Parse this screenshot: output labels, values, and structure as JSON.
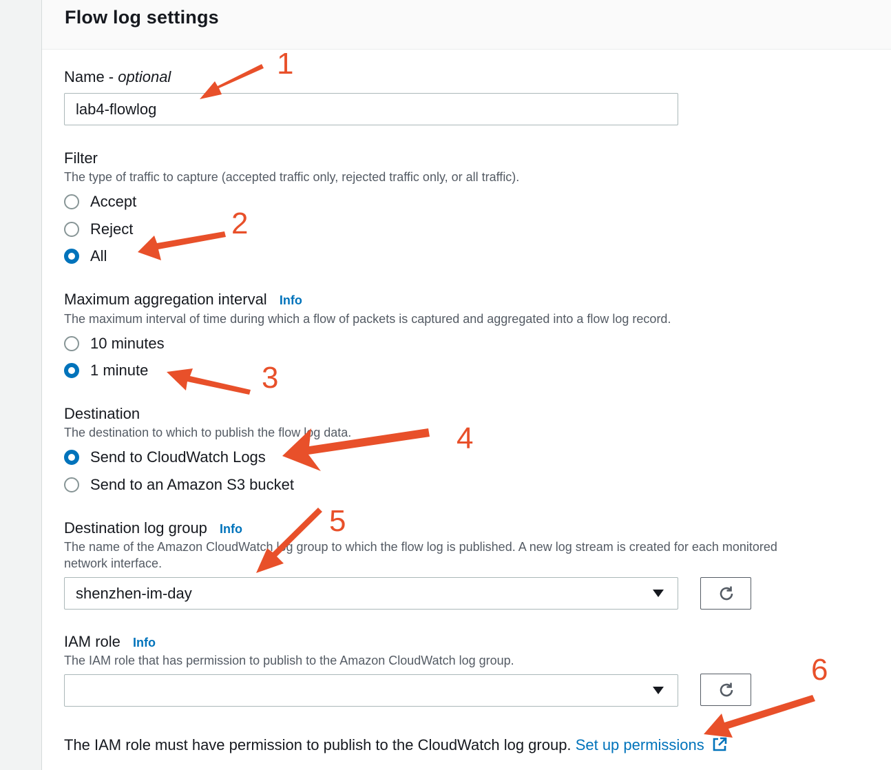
{
  "panel": {
    "title": "Flow log settings"
  },
  "name_field": {
    "label": "Name - ",
    "optional": "optional",
    "value": "lab4-flowlog"
  },
  "filter": {
    "label": "Filter",
    "description": "The type of traffic to capture (accepted traffic only, rejected traffic only, or all traffic).",
    "options": [
      {
        "label": "Accept",
        "checked": false
      },
      {
        "label": "Reject",
        "checked": false
      },
      {
        "label": "All",
        "checked": true
      }
    ]
  },
  "aggregation": {
    "label": "Maximum aggregation interval",
    "info": "Info",
    "description": "The maximum interval of time during which a flow of packets is captured and aggregated into a flow log record.",
    "options": [
      {
        "label": "10 minutes",
        "checked": false
      },
      {
        "label": "1 minute",
        "checked": true
      }
    ]
  },
  "destination": {
    "label": "Destination",
    "description": "The destination to which to publish the flow log data.",
    "options": [
      {
        "label": "Send to CloudWatch Logs",
        "checked": true
      },
      {
        "label": "Send to an Amazon S3 bucket",
        "checked": false
      }
    ]
  },
  "log_group": {
    "label": "Destination log group",
    "info": "Info",
    "description_line1": "The name of the Amazon CloudWatch log group to which the flow log is published. A new log stream is created for each monitored",
    "description_line2": "network interface.",
    "value": "shenzhen-im-day"
  },
  "iam_role": {
    "label": "IAM role",
    "info": "Info",
    "description": "The IAM role that has permission to publish to the Amazon CloudWatch log group.",
    "value": ""
  },
  "footer": {
    "note": "The IAM role must have permission to publish to the CloudWatch log group.",
    "link": "Set up permissions"
  },
  "annotations": [
    "1",
    "2",
    "3",
    "4",
    "5",
    "6"
  ],
  "colors": {
    "accent": "#0073bb",
    "annotation": "#e8502a"
  }
}
